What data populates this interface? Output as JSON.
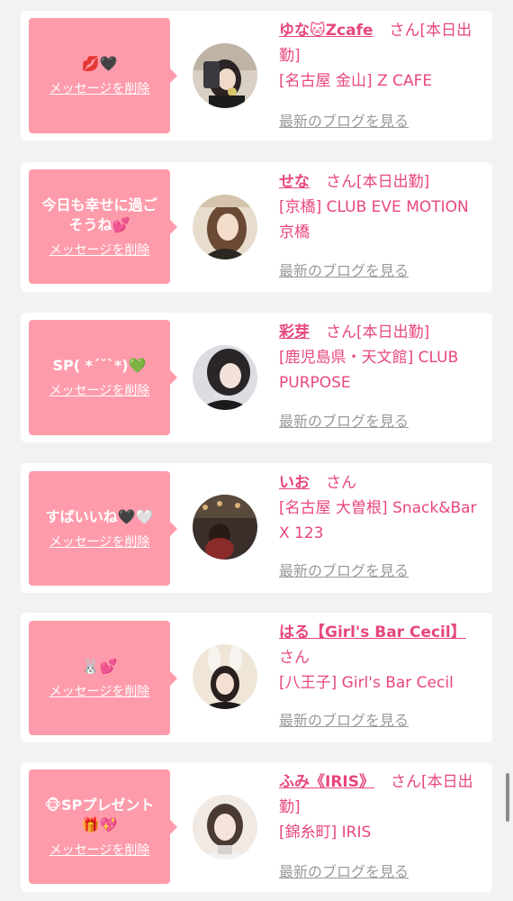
{
  "delete_label": "メッセージを削除",
  "blog_label": "最新のブログを見る",
  "colors": {
    "bubble": "#fe9bab",
    "accent": "#e8477a",
    "muted": "#9a9a9a",
    "background": "#f2f2f2"
  },
  "cards": [
    {
      "message": "💋🖤",
      "name": "ゆな🐱Zcafe",
      "suffix": "さん[本日出勤]",
      "shop": "[名古屋 金山] Z CAFE",
      "avatar_icon": "avatar-photo"
    },
    {
      "message": "今日も幸せに過ごそうね💕",
      "name": "せな",
      "suffix": "さん[本日出勤]",
      "shop": "[京橋] CLUB EVE MOTION 京橋",
      "avatar_icon": "avatar-photo"
    },
    {
      "message": "SP( *´˘`*)💚",
      "name": "彩芽",
      "suffix": "さん[本日出勤]",
      "shop": "[鹿児島県・天文館] CLUB PURPOSE",
      "avatar_icon": "avatar-photo"
    },
    {
      "message": "すばいいね🖤🤍",
      "name": "いお",
      "suffix": "さん",
      "shop": "[名古屋 大曽根] Snack&Bar X 123",
      "avatar_icon": "avatar-photo"
    },
    {
      "message": "🐰💕",
      "name": "はる【Girl's Bar Cecil】",
      "suffix": "さん",
      "shop": "[八王子] Girl's Bar Cecil",
      "avatar_icon": "avatar-photo"
    },
    {
      "message": "🐵SPプレゼント🎁💖",
      "name": "ふみ《IRIS》",
      "suffix": "さん[本日出勤]",
      "shop": "[錦糸町] IRIS",
      "avatar_icon": "avatar-photo"
    }
  ]
}
